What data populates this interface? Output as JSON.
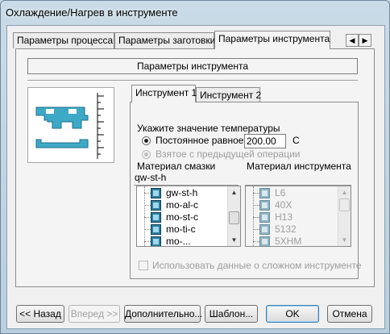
{
  "window": {
    "title": "Охлаждение/Нагрев в инструменте"
  },
  "tabs": [
    {
      "label": "Параметры процесса",
      "active": false
    },
    {
      "label": "Параметры заготовки",
      "active": false
    },
    {
      "label": "Параметры инструмента",
      "active": true
    }
  ],
  "tab_scroll": {
    "left_icon": "arrow-left-icon",
    "right_icon": "arrow-right-icon",
    "left_glyph": "◀",
    "right_glyph": "▶"
  },
  "group_title": "Параметры инструмента",
  "tool_tabs": [
    {
      "label": "Инструмент 1",
      "active": true
    },
    {
      "label": "Инструмент 2",
      "active": false
    }
  ],
  "temperature": {
    "prompt": "Укажите значение температуры",
    "constant_label": "Постоянное равное",
    "constant_selected": true,
    "value": "200.00",
    "unit": "C",
    "previous_label": "Взятое с предыдущей операции",
    "previous_enabled": false
  },
  "lubricant": {
    "label": "Материал смазки",
    "current": "qw-st-h",
    "items": [
      "gw-st-h",
      "mo-al-c",
      "mo-st-c",
      "mo-ti-c",
      "mo-..."
    ]
  },
  "tool_material": {
    "label": "Материал инструмента",
    "current": "",
    "items": [
      "L6",
      "40X",
      "H13",
      "5132",
      "5XHM"
    ],
    "enabled": false
  },
  "complex_tool": {
    "label": "Использовать данные о сложном инструменте",
    "checked": false,
    "enabled": false
  },
  "scroll_glyphs": {
    "up": "▲",
    "down": "▼"
  },
  "buttons": {
    "back": "<< Назад",
    "forward": "Вперед >>",
    "advanced": "Дополнительно...",
    "template": "Шаблон...",
    "ok": "OK",
    "cancel": "Отмена"
  },
  "colors": {
    "die": "#3ea9c7",
    "die_dark": "#1e6f87"
  }
}
